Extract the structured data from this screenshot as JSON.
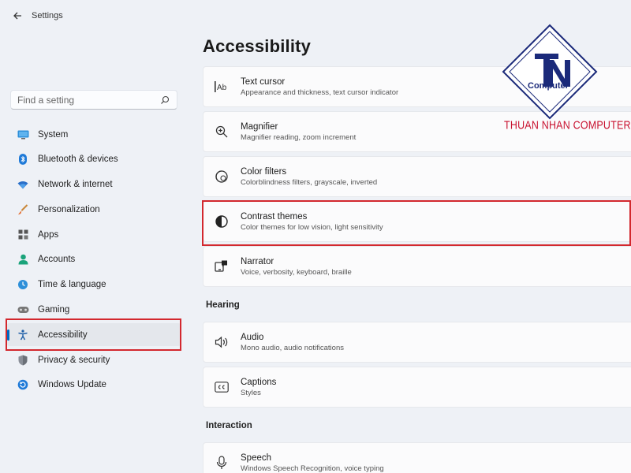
{
  "app": {
    "title": "Settings"
  },
  "search": {
    "placeholder": "Find a setting"
  },
  "sidebar": {
    "items": [
      {
        "label": "System",
        "icon": "monitor-icon"
      },
      {
        "label": "Bluetooth & devices",
        "icon": "bluetooth-icon"
      },
      {
        "label": "Network & internet",
        "icon": "wifi-icon"
      },
      {
        "label": "Personalization",
        "icon": "brush-icon"
      },
      {
        "label": "Apps",
        "icon": "apps-icon"
      },
      {
        "label": "Accounts",
        "icon": "person-icon"
      },
      {
        "label": "Time & language",
        "icon": "globe-clock-icon"
      },
      {
        "label": "Gaming",
        "icon": "gamepad-icon"
      },
      {
        "label": "Accessibility",
        "icon": "accessibility-icon",
        "selected": true
      },
      {
        "label": "Privacy & security",
        "icon": "shield-icon"
      },
      {
        "label": "Windows Update",
        "icon": "update-icon"
      }
    ]
  },
  "main": {
    "title": "Accessibility",
    "vision_items": [
      {
        "title": "Text cursor",
        "subtitle": "Appearance and thickness, text cursor indicator",
        "icon": "text-cursor-icon"
      },
      {
        "title": "Magnifier",
        "subtitle": "Magnifier reading, zoom increment",
        "icon": "magnifier-icon"
      },
      {
        "title": "Color filters",
        "subtitle": "Colorblindness filters, grayscale, inverted",
        "icon": "color-filter-icon"
      },
      {
        "title": "Contrast themes",
        "subtitle": "Color themes for low vision, light sensitivity",
        "icon": "contrast-icon"
      },
      {
        "title": "Narrator",
        "subtitle": "Voice, verbosity, keyboard, braille",
        "icon": "narrator-icon"
      }
    ],
    "hearing_heading": "Hearing",
    "hearing_items": [
      {
        "title": "Audio",
        "subtitle": "Mono audio, audio notifications",
        "icon": "speaker-icon"
      },
      {
        "title": "Captions",
        "subtitle": "Styles",
        "icon": "captions-icon"
      }
    ],
    "interaction_heading": "Interaction",
    "interaction_items": [
      {
        "title": "Speech",
        "subtitle": "Windows Speech Recognition, voice typing",
        "icon": "microphone-icon"
      }
    ]
  },
  "watermark": {
    "logo_text": "Computer",
    "brand_text": "THUAN NHAN COMPUTER"
  },
  "colors": {
    "accent": "#0067c0",
    "highlight": "#d3282e",
    "brand": "#c8102e",
    "logo_navy": "#1b2a7a"
  }
}
